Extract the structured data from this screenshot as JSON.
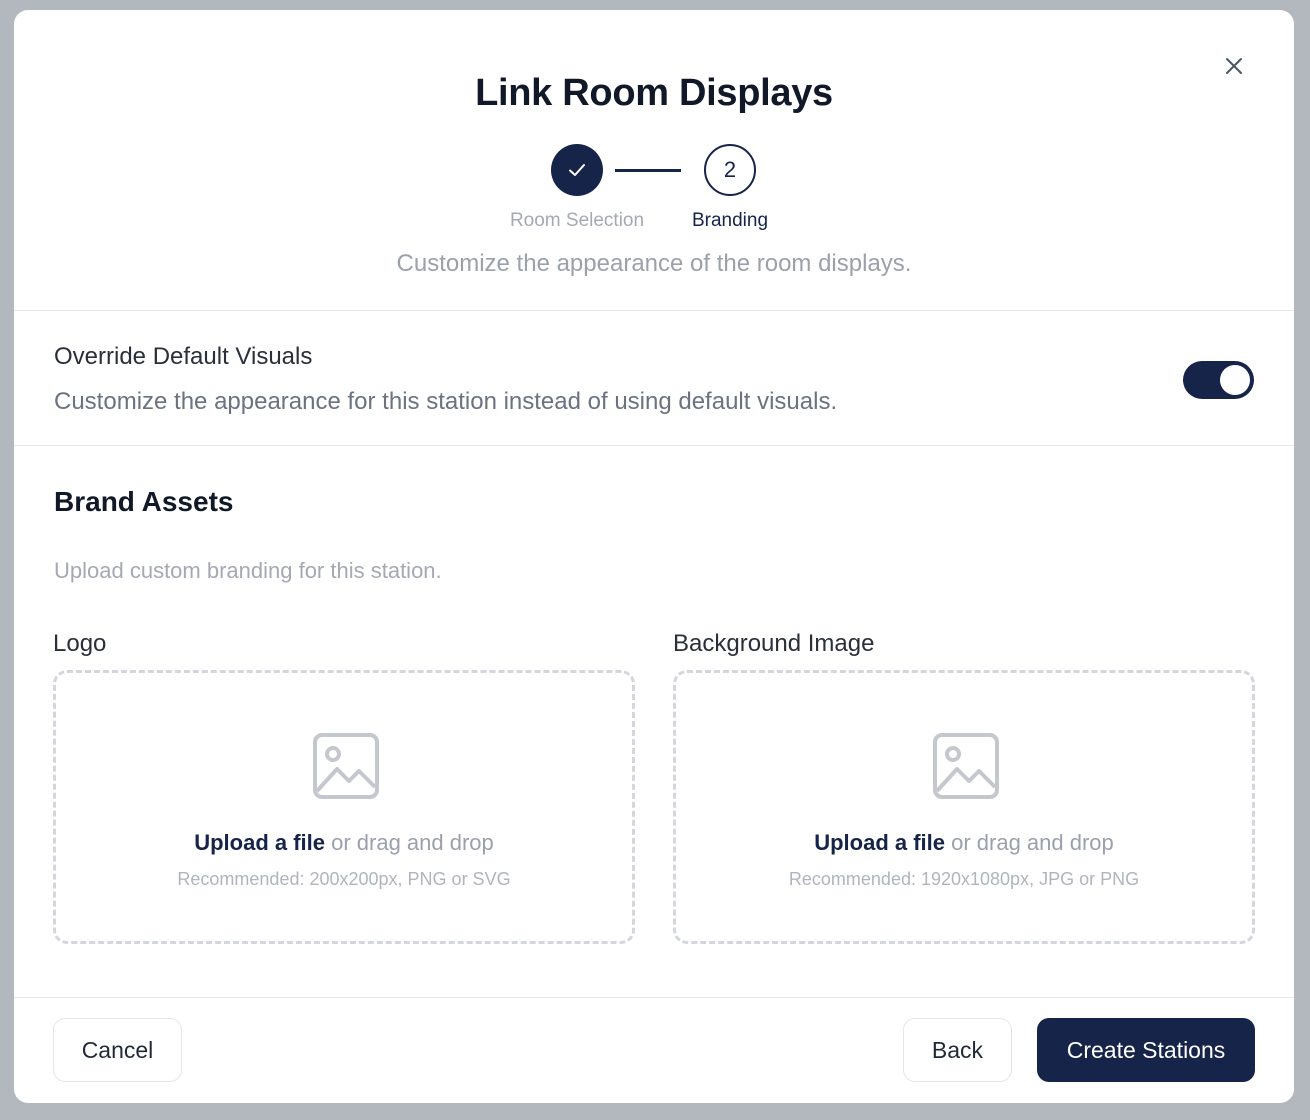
{
  "modal": {
    "title": "Link Room Displays",
    "subtitle": "Customize the appearance of the room displays."
  },
  "stepper": {
    "steps": [
      {
        "label": "Room Selection",
        "status": "completed",
        "icon": "check-icon"
      },
      {
        "label": "Branding",
        "status": "current",
        "number": "2"
      }
    ]
  },
  "override": {
    "title": "Override Default Visuals",
    "description": "Customize the appearance for this station instead of using default visuals.",
    "enabled": true
  },
  "brand_assets": {
    "title": "Brand Assets",
    "description": "Upload custom branding for this station.",
    "uploads": [
      {
        "label": "Logo",
        "link_text": "Upload a file",
        "rest_text": " or drag and drop",
        "hint": "Recommended: 200x200px, PNG or SVG",
        "icon": "image-icon"
      },
      {
        "label": "Background Image",
        "link_text": "Upload a file",
        "rest_text": " or drag and drop",
        "hint": "Recommended: 1920x1080px, JPG or PNG",
        "icon": "image-icon"
      }
    ]
  },
  "footer": {
    "cancel_label": "Cancel",
    "back_label": "Back",
    "create_label": "Create Stations"
  },
  "colors": {
    "primary": "#16244a",
    "muted_text": "#9aa1ac",
    "border": "#e6e8ec"
  }
}
